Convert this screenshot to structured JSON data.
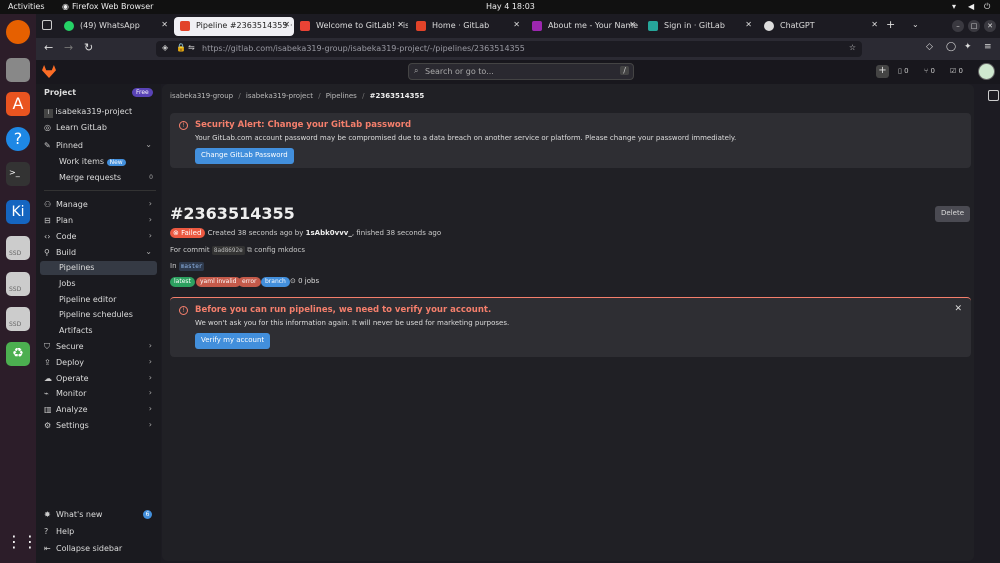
{
  "os": {
    "activities": "Activities",
    "app": "Firefox Web Browser",
    "clock": "Hay 4  18:03"
  },
  "tabs": [
    {
      "label": "(49) WhatsApp"
    },
    {
      "label": "Pipeline #2363514355 · i"
    },
    {
      "label": "Welcome to GitLab! - isab"
    },
    {
      "label": "Home · GitLab"
    },
    {
      "label": "About me - Your Name - /"
    },
    {
      "label": "Sign in · GitLab"
    },
    {
      "label": "ChatGPT"
    }
  ],
  "url": "https://gitlab.com/isabeka319-group/isabeka319-project/-/pipelines/2363514355",
  "header": {
    "search_placeholder": "Search or go to...",
    "search_shortcut": "/",
    "counts": [
      "0",
      "0",
      "0"
    ]
  },
  "sidebar": {
    "section": "Project",
    "badge": "Free",
    "project": "isabeka319-project",
    "project_initial": "I",
    "learn": "Learn GitLab",
    "pinned": "Pinned",
    "work_items": "Work items",
    "work_items_badge": "New",
    "merge_requests": "Merge requests",
    "merge_requests_count": "0",
    "items": [
      "Manage",
      "Plan",
      "Code",
      "Build"
    ],
    "build_sub": [
      "Pipelines",
      "Jobs",
      "Pipeline editor",
      "Pipeline schedules",
      "Artifacts"
    ],
    "items2": [
      "Secure",
      "Deploy",
      "Operate",
      "Monitor",
      "Analyze",
      "Settings"
    ],
    "whats_new": "What's new",
    "whats_new_count": "6",
    "help": "Help",
    "collapse": "Collapse sidebar"
  },
  "breadcrumb": [
    "isabeka319-group",
    "isabeka319-project",
    "Pipelines",
    "#2363514355"
  ],
  "security_alert": {
    "title": "Security Alert: Change your GitLab password",
    "body": "Your GitLab.com account password may be compromised due to a data breach on another service or platform. Please change your password immediately.",
    "button": "Change GitLab Password"
  },
  "pipeline": {
    "title": "#2363514355",
    "delete": "Delete",
    "status": "Failed",
    "created": "Created 38 seconds ago by",
    "user": "1sAbk0vvv_",
    "finished": ", finished 38 seconds ago",
    "for_commit": "For commit",
    "commit": "8ad8692e",
    "commit_msg": "config mkdocs",
    "in": "In",
    "branch": "master",
    "labels": [
      "latest",
      "yaml invalid",
      "error",
      "branch"
    ],
    "jobs": "0 jobs"
  },
  "verify_alert": {
    "title": "Before you can run pipelines, we need to verify your account.",
    "body": "We won't ask you for this information again. It will never be used for marketing purposes.",
    "button": "Verify my account"
  },
  "colors": {
    "danger": "#f57f6c",
    "primary": "#428fdc",
    "failed_bg": "#ec5941"
  }
}
